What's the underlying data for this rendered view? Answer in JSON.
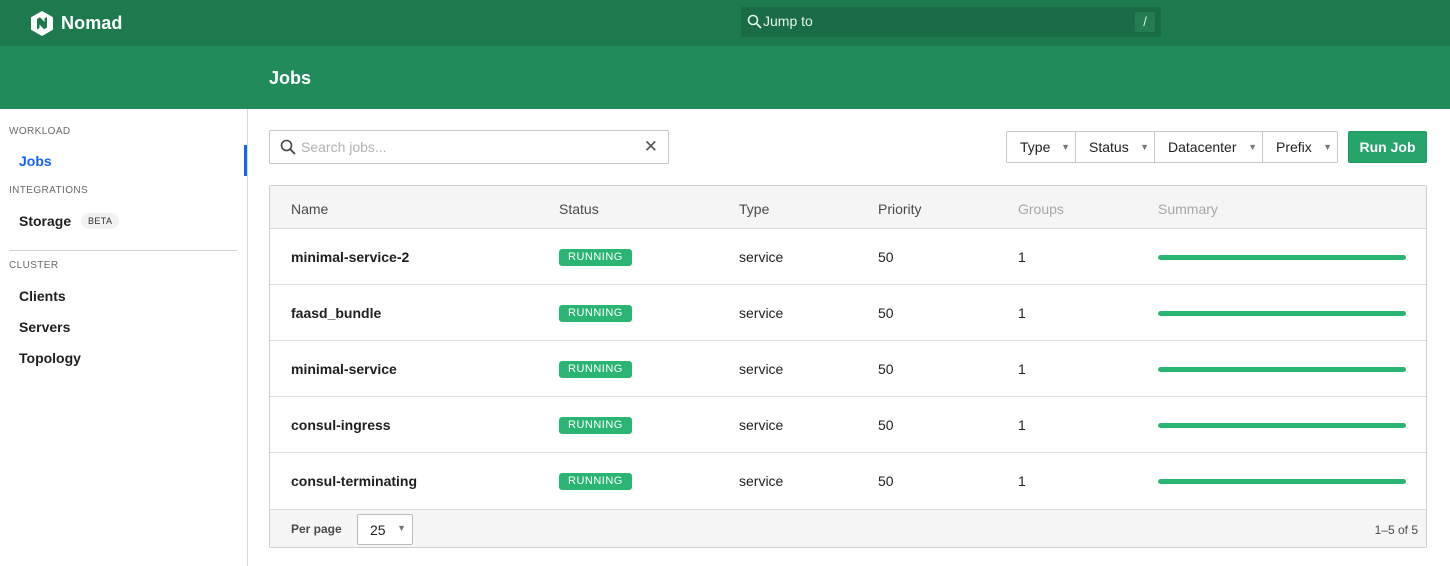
{
  "app": {
    "name": "Nomad",
    "logo_icon": "nomad-logo-icon"
  },
  "jump": {
    "label": "Jump to",
    "shortcut": "/"
  },
  "page": {
    "title": "Jobs"
  },
  "sidebar": {
    "sections": {
      "workload": "WORKLOAD",
      "integrations": "INTEGRATIONS",
      "cluster": "CLUSTER"
    },
    "items": {
      "jobs": "Jobs",
      "storage": "Storage",
      "storage_badge": "BETA",
      "clients": "Clients",
      "servers": "Servers",
      "topology": "Topology"
    },
    "active": "jobs"
  },
  "search": {
    "placeholder": "Search jobs...",
    "value": ""
  },
  "filters": {
    "type": "Type",
    "status": "Status",
    "datacenter": "Datacenter",
    "prefix": "Prefix"
  },
  "run_job": "Run Job",
  "table": {
    "columns": {
      "name": "Name",
      "status": "Status",
      "type": "Type",
      "priority": "Priority",
      "groups": "Groups",
      "summary": "Summary"
    },
    "rows": [
      {
        "name": "minimal-service-2",
        "status": "RUNNING",
        "type": "service",
        "priority": "50",
        "groups": "1",
        "summary_fraction": 1.0
      },
      {
        "name": "faasd_bundle",
        "status": "RUNNING",
        "type": "service",
        "priority": "50",
        "groups": "1",
        "summary_fraction": 1.0
      },
      {
        "name": "minimal-service",
        "status": "RUNNING",
        "type": "service",
        "priority": "50",
        "groups": "1",
        "summary_fraction": 1.0
      },
      {
        "name": "consul-ingress",
        "status": "RUNNING",
        "type": "service",
        "priority": "50",
        "groups": "1",
        "summary_fraction": 1.0
      },
      {
        "name": "consul-terminating",
        "status": "RUNNING",
        "type": "service",
        "priority": "50",
        "groups": "1",
        "summary_fraction": 1.0
      }
    ]
  },
  "pagination": {
    "per_page_label": "Per page",
    "per_page": "25",
    "range": "1–5 of 5"
  },
  "colors": {
    "header": "#1c7a4e",
    "subheader": "#218b5b",
    "accent": "#1563ff",
    "running": "#2bb574"
  }
}
